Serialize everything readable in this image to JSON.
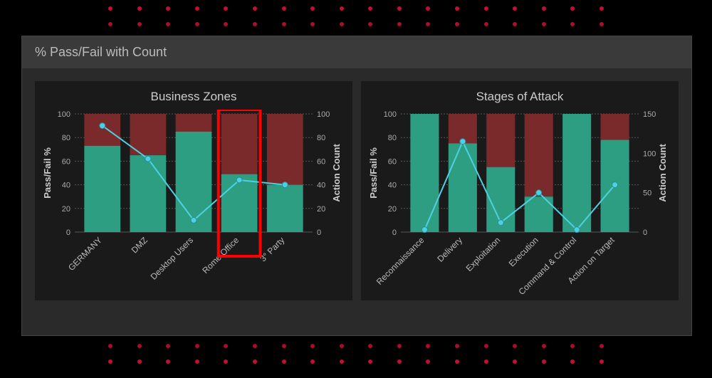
{
  "header": {
    "title": "% Pass/Fail with Count"
  },
  "chart_data": [
    {
      "id": "zones",
      "type": "bar",
      "title": "Business Zones",
      "categories": [
        "GERMANY",
        "DMZ",
        "Desktop Users",
        "Rome Office",
        "3° Party"
      ],
      "pass_pct": [
        73,
        65,
        85,
        49,
        40
      ],
      "fail_pct": [
        27,
        35,
        15,
        51,
        60
      ],
      "action_count": [
        90,
        62,
        10,
        44,
        40
      ],
      "ylabel_left": "Pass/Fail %",
      "ylabel_right": "Action Count",
      "ylim_left": [
        0,
        100
      ],
      "ylim_right": [
        0,
        100
      ],
      "yticks_left": [
        0,
        20,
        40,
        60,
        80,
        100
      ],
      "yticks_right": [
        0,
        20,
        40,
        60,
        80,
        100
      ],
      "highlight_category": "Rome Office"
    },
    {
      "id": "stages",
      "type": "bar",
      "title": "Stages of Attack",
      "categories": [
        "Reconnaissance",
        "Delivery",
        "Exploitation",
        "Execution",
        "Command & Control",
        "Action on Target"
      ],
      "pass_pct": [
        100,
        75,
        55,
        30,
        100,
        78
      ],
      "fail_pct": [
        0,
        25,
        45,
        70,
        0,
        22
      ],
      "action_count": [
        3,
        115,
        12,
        50,
        3,
        60
      ],
      "ylabel_left": "Pass/Fail %",
      "ylabel_right": "Action Count",
      "ylim_left": [
        0,
        100
      ],
      "ylim_right": [
        0,
        150
      ],
      "yticks_left": [
        0,
        20,
        40,
        60,
        80,
        100
      ],
      "yticks_right": [
        0,
        50,
        100,
        150
      ]
    }
  ],
  "colors": {
    "pass": "#2e9e82",
    "fail": "#7a2a2a",
    "line": "#4dd0e1"
  }
}
